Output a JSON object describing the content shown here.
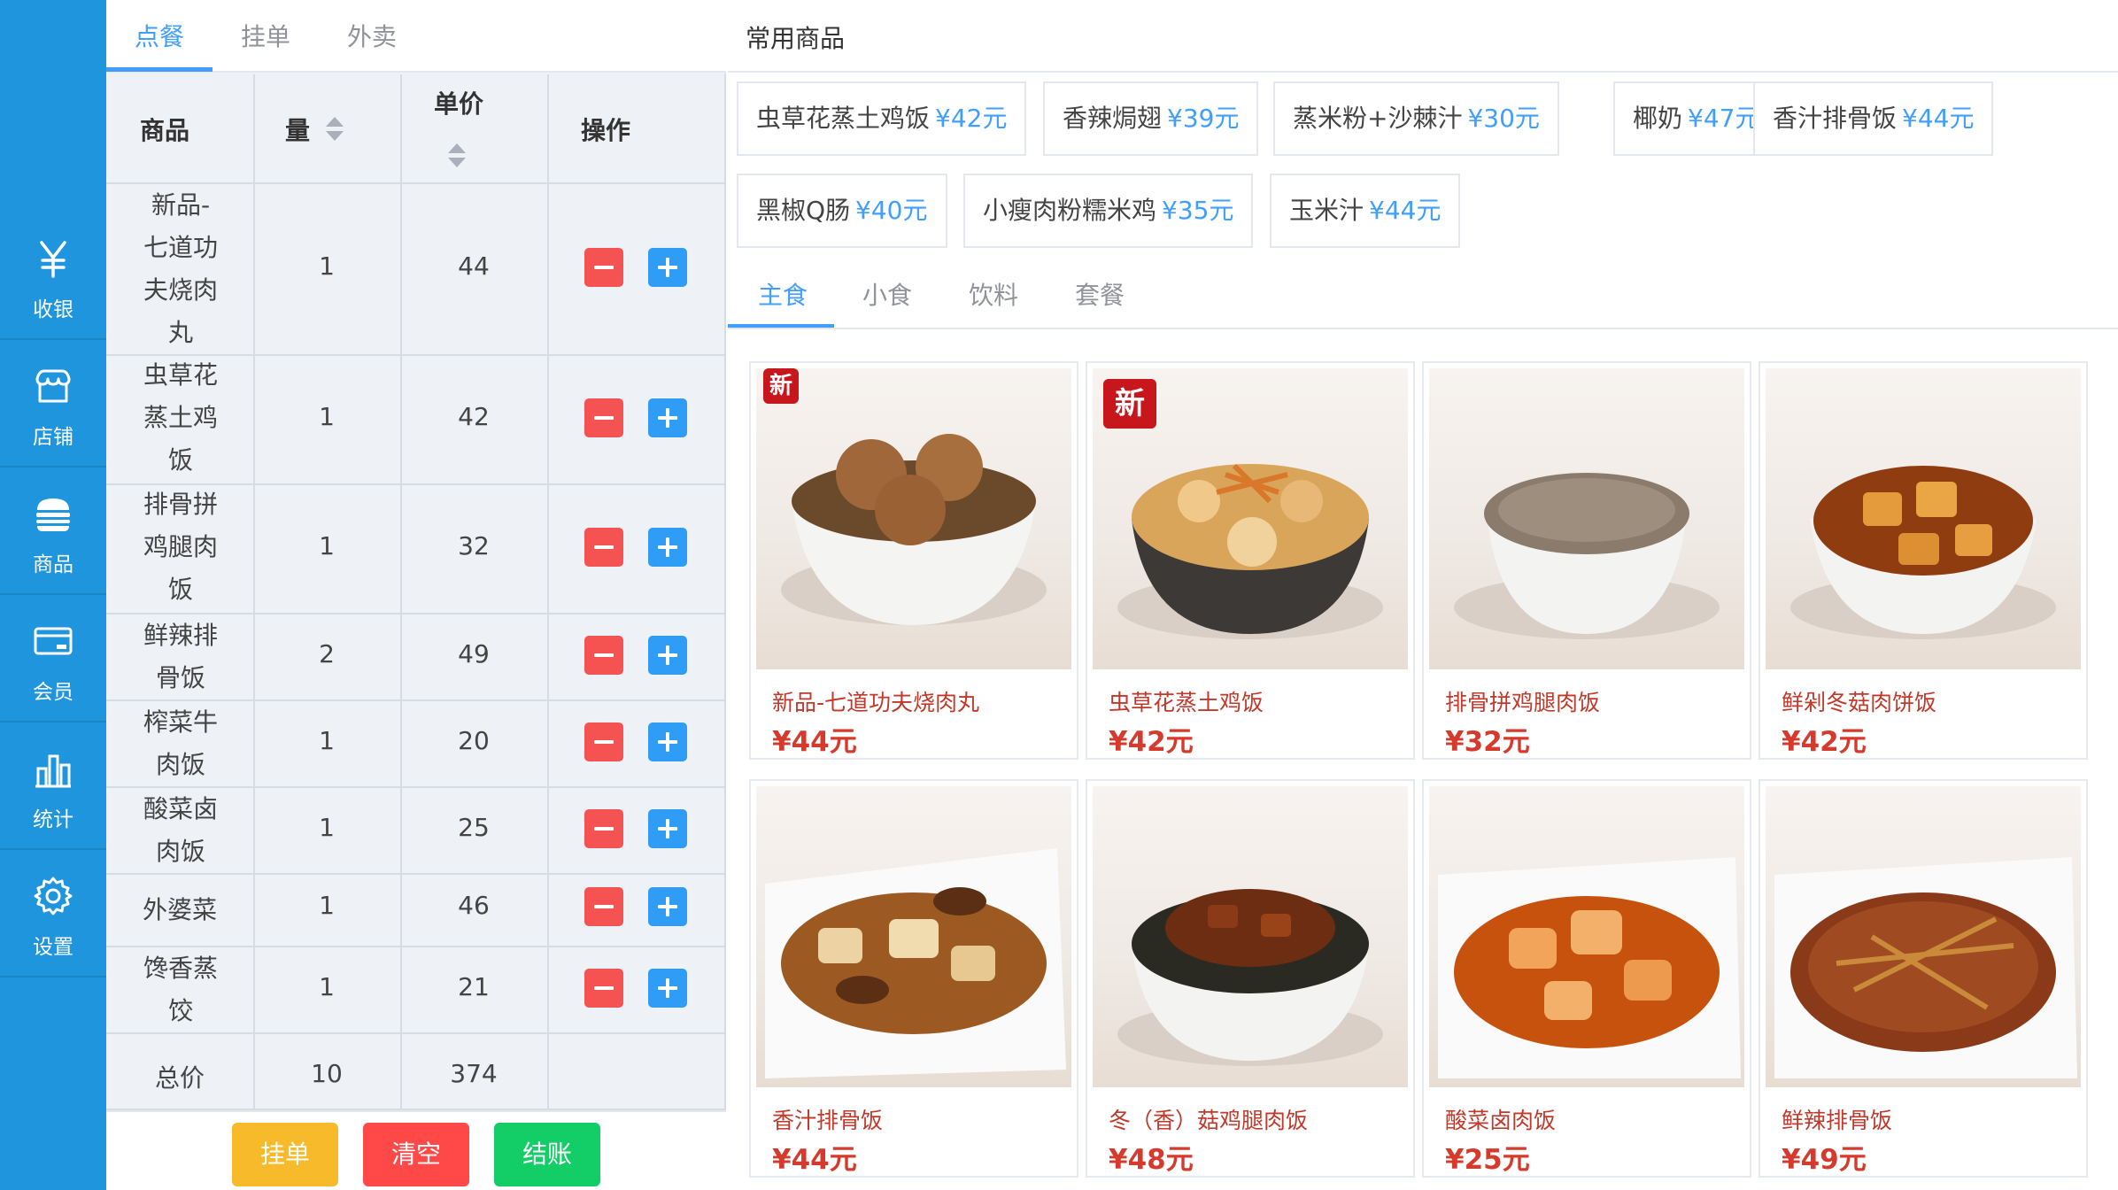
{
  "sidebar": {
    "items": [
      {
        "label": "收银",
        "icon": "yen-icon"
      },
      {
        "label": "店铺",
        "icon": "store-icon"
      },
      {
        "label": "商品",
        "icon": "burger-icon"
      },
      {
        "label": "会员",
        "icon": "vip-card-icon"
      },
      {
        "label": "统计",
        "icon": "bar-stats-icon"
      },
      {
        "label": "设置",
        "icon": "gear-icon"
      }
    ]
  },
  "order": {
    "tabs": [
      "点餐",
      "挂单",
      "外卖"
    ],
    "active_tab": "点餐",
    "columns": {
      "item": "商品",
      "qty": "量",
      "price": "单价",
      "action": "操作"
    },
    "rows": [
      {
        "name": "新品-七道功夫烧肉丸",
        "qty": "1",
        "price": "44"
      },
      {
        "name": "虫草花蒸土鸡饭",
        "qty": "1",
        "price": "42"
      },
      {
        "name": "排骨拼鸡腿肉饭",
        "qty": "1",
        "price": "32"
      },
      {
        "name": "鲜辣排骨饭",
        "qty": "2",
        "price": "49"
      },
      {
        "name": "榨菜牛肉饭",
        "qty": "1",
        "price": "20"
      },
      {
        "name": "酸菜卤肉饭",
        "qty": "1",
        "price": "25"
      },
      {
        "name": "外婆菜",
        "qty": "1",
        "price": "46"
      },
      {
        "name": "馋香蒸饺",
        "qty": "1",
        "price": "21"
      }
    ],
    "total": {
      "label": "总价",
      "qty": "10",
      "price": "374"
    },
    "buttons": {
      "hold": "挂单",
      "clear": "清空",
      "checkout": "结账"
    }
  },
  "favorites": {
    "title": "常用商品",
    "items": [
      {
        "name": "虫草花蒸土鸡饭",
        "price": "¥42元"
      },
      {
        "name": "香辣焗翅",
        "price": "¥39元"
      },
      {
        "name": "蒸米粉+沙棘汁",
        "price": "¥30元"
      },
      {
        "name": "椰奶",
        "price": "¥47元"
      },
      {
        "name": "香汁排骨饭",
        "price": "¥44元"
      },
      {
        "name": "黑椒Q肠",
        "price": "¥40元"
      },
      {
        "name": "小瘦肉粉糯米鸡",
        "price": "¥35元"
      },
      {
        "name": "玉米汁",
        "price": "¥44元"
      }
    ]
  },
  "categories": {
    "tabs": [
      "主食",
      "小食",
      "饮料",
      "套餐"
    ],
    "active": "主食"
  },
  "products": [
    {
      "name": "新品-七道功夫烧肉丸",
      "price": "¥44元",
      "badge": "新"
    },
    {
      "name": "虫草花蒸土鸡饭",
      "price": "¥42元",
      "badge": "新"
    },
    {
      "name": "排骨拼鸡腿肉饭",
      "price": "¥32元"
    },
    {
      "name": "鲜剁冬菇肉饼饭",
      "price": "¥42元"
    },
    {
      "name": "香汁排骨饭",
      "price": "¥44元"
    },
    {
      "name": "冬（香）菇鸡腿肉饭",
      "price": "¥48元"
    },
    {
      "name": "酸菜卤肉饭",
      "price": "¥25元"
    },
    {
      "name": "鲜辣排骨饭",
      "price": "¥49元"
    }
  ],
  "colors": {
    "brand": "#1e95dd",
    "accent": "#409eff",
    "danger": "#f55352",
    "warning": "#f7ba2a",
    "success": "#13ce66",
    "price": "#d63a2c"
  }
}
